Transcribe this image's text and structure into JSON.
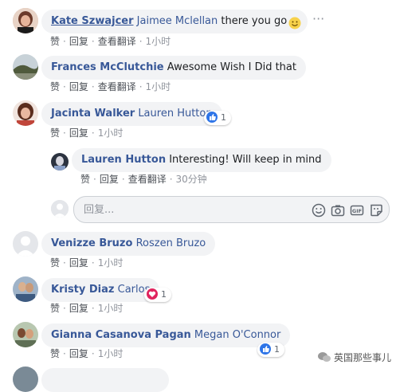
{
  "comments": [
    {
      "name": "Kate Szwajcer",
      "mention": "Jaimee Mclellan",
      "text": "there you go",
      "actions": {
        "like": "赞",
        "reply": "回复",
        "translate": "查看翻译",
        "time": "1小时"
      }
    },
    {
      "name": "Frances McClutchie",
      "text": "Awesome Wish I Did that",
      "actions": {
        "like": "赞",
        "reply": "回复",
        "translate": "查看翻译",
        "time": "1小时"
      }
    },
    {
      "name": "Jacinta Walker",
      "mention": "Lauren Hutton",
      "reaction": {
        "type": "like",
        "count": "1"
      },
      "actions": {
        "like": "赞",
        "reply": "回复",
        "time": "1小时"
      }
    },
    {
      "name": "Lauren Hutton",
      "text": "Interesting! Will keep in mind",
      "actions": {
        "like": "赞",
        "reply": "回复",
        "translate": "查看翻译",
        "time": "30分钟"
      }
    },
    {
      "name": "Venizze Bruzo",
      "mention": "Roszen Bruzo",
      "actions": {
        "like": "赞",
        "reply": "回复",
        "time": "1小时"
      }
    },
    {
      "name": "Kristy Diaz",
      "mention": "Carlos",
      "reaction": {
        "type": "love",
        "count": "1"
      },
      "actions": {
        "like": "赞",
        "reply": "回复",
        "time": "1小时"
      }
    },
    {
      "name": "Gianna Casanova Pagan",
      "mention": "Megan O'Connor",
      "reaction": {
        "type": "like",
        "count": "1"
      },
      "actions": {
        "like": "赞",
        "reply": "回复",
        "time": "1小时"
      }
    }
  ],
  "reply_box": {
    "placeholder": "回复..."
  },
  "more_menu": "···",
  "watermark": "英国那些事儿",
  "colors": {
    "name": "#385898",
    "bubble": "#f2f3f5",
    "meta": "#90949c",
    "like_blue": "#2e75e8",
    "love_red": "#e0245e"
  }
}
